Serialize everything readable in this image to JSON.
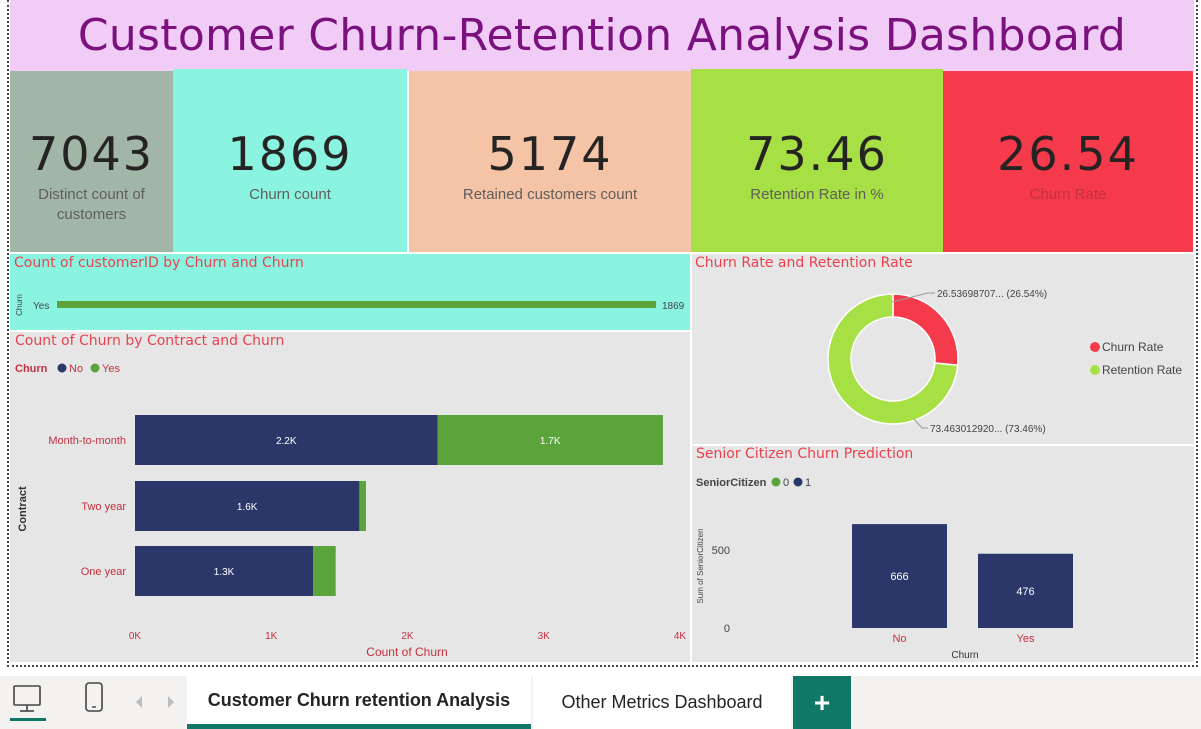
{
  "dashboard": {
    "title": "Customer Churn-Retention Analysis Dashboard"
  },
  "kpis": [
    {
      "value": "7043",
      "label": "Distinct count of customers",
      "color": "#a2b6a8"
    },
    {
      "value": "1869",
      "label": "Churn count",
      "color": "#8bf4e1"
    },
    {
      "value": "5174",
      "label": "Retained customers count",
      "color": "#f5c4a6"
    },
    {
      "value": "73.46",
      "label": "Retention Rate in %",
      "color": "#a7e045"
    },
    {
      "value": "26.54",
      "label": "Churn Rate",
      "color": "#f53a4c"
    }
  ],
  "charts": {
    "count_by_churn": {
      "title": "Count of customerID by Churn and Churn",
      "axis_label": "Churn",
      "bar_label": "Yes",
      "value_label": "1869"
    },
    "contract": {
      "title": "Count of Churn by Contract and Churn",
      "legend_title": "Churn",
      "legend_no": "No",
      "legend_yes": "Yes",
      "ylabel": "Contract",
      "xlabel": "Count of Churn",
      "xticks": [
        "0K",
        "1K",
        "2K",
        "3K",
        "4K"
      ]
    },
    "donut": {
      "title": "Churn Rate and Retention Rate",
      "label_churn": "26.53698707... (26.54%)",
      "label_retention": "73.463012920... (73.46%)",
      "legend_churn": "Churn Rate",
      "legend_retention": "Retention Rate"
    },
    "senior": {
      "title": "Senior Citizen Churn Prediction",
      "legend_title": "SeniorCitizen",
      "legend_0": "0",
      "legend_1": "1",
      "ylabel": "Sum of SeniorCitizen",
      "xlabel": "Churn",
      "yticks": [
        "500",
        "0"
      ]
    }
  },
  "chart_data": [
    {
      "type": "bar",
      "orientation": "horizontal",
      "title": "Count of customerID by Churn and Churn",
      "categories": [
        "Yes"
      ],
      "values": [
        1869
      ],
      "ylabel": "Churn"
    },
    {
      "type": "bar",
      "orientation": "horizontal",
      "stacked": true,
      "title": "Count of Churn by Contract and Churn",
      "categories": [
        "Month-to-month",
        "Two year",
        "One year"
      ],
      "series": [
        {
          "name": "No",
          "values": [
            2220,
            1647,
            1307
          ],
          "labels": [
            "2.2K",
            "1.6K",
            "1.3K"
          ],
          "color": "#2c3769"
        },
        {
          "name": "Yes",
          "values": [
            1655,
            48,
            166
          ],
          "labels": [
            "1.7K",
            "",
            ""
          ],
          "color": "#5ba33b"
        }
      ],
      "xlabel": "Count of Churn",
      "ylabel": "Contract",
      "xlim": [
        0,
        4000
      ],
      "legend": "top-left"
    },
    {
      "type": "pie",
      "donut": true,
      "title": "Churn Rate and Retention Rate",
      "categories": [
        "Churn Rate",
        "Retention Rate"
      ],
      "values": [
        26.53698707,
        73.46301292
      ],
      "colors": [
        "#f53a4c",
        "#a7e045"
      ],
      "legend": "right"
    },
    {
      "type": "bar",
      "title": "Senior Citizen Churn Prediction",
      "categories": [
        "No",
        "Yes"
      ],
      "series": [
        {
          "name": "1",
          "values": [
            666,
            476
          ],
          "color": "#2c3769"
        }
      ],
      "xlabel": "Churn",
      "ylabel": "Sum of SeniorCitizen",
      "ylim": [
        0,
        700
      ],
      "legend": "top-left"
    }
  ],
  "bottom_tabs": {
    "active": "Customer Churn retention Analysis",
    "other": "Other Metrics Dashboard",
    "add": "+",
    "accent": "#117865"
  }
}
